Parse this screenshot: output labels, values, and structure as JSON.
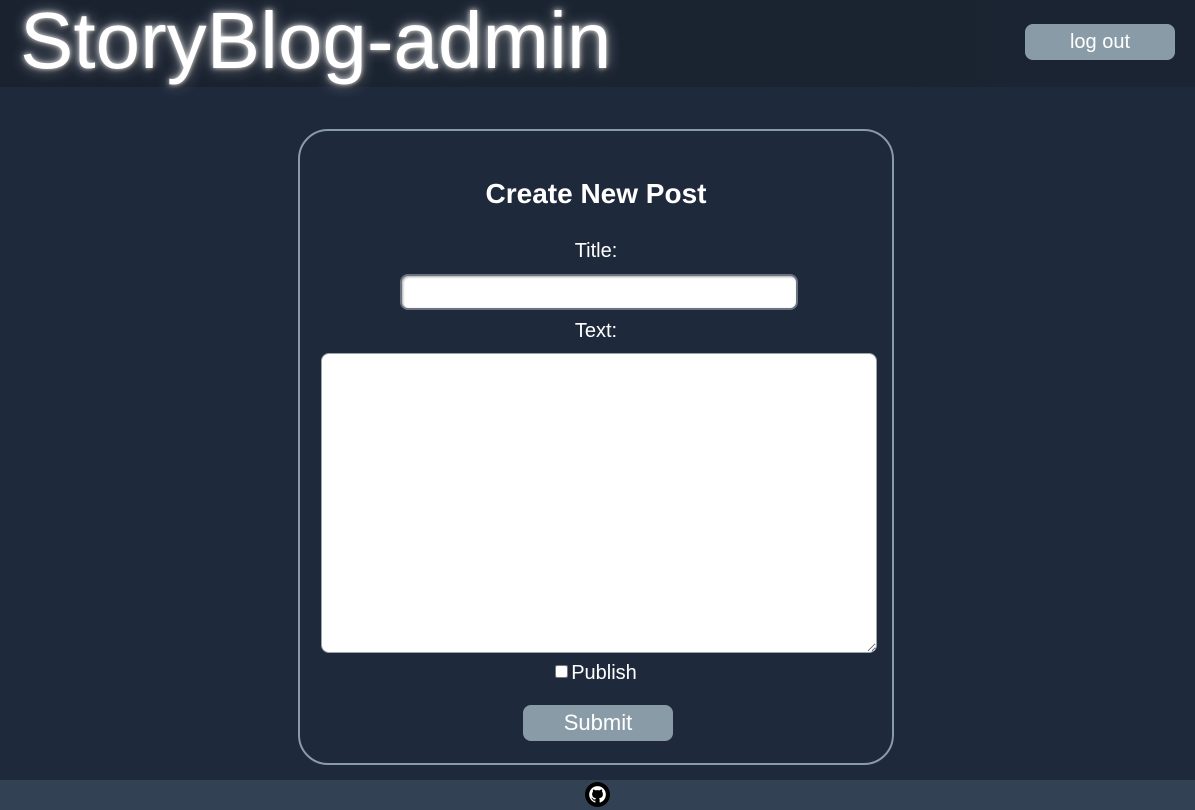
{
  "header": {
    "brand": "StoryBlog-admin",
    "logout_label": "log out"
  },
  "form": {
    "heading": "Create New Post",
    "title_label": "Title:",
    "title_value": "",
    "text_label": "Text:",
    "text_value": "",
    "publish_label": "Publish",
    "publish_checked": false,
    "submit_label": "Submit"
  },
  "footer": {
    "icon": "github-icon"
  },
  "colors": {
    "background": "#1e293b",
    "header": "#1a2230",
    "button": "#8a9ba8",
    "card_border": "#8a9ba8",
    "footer": "#334155"
  }
}
